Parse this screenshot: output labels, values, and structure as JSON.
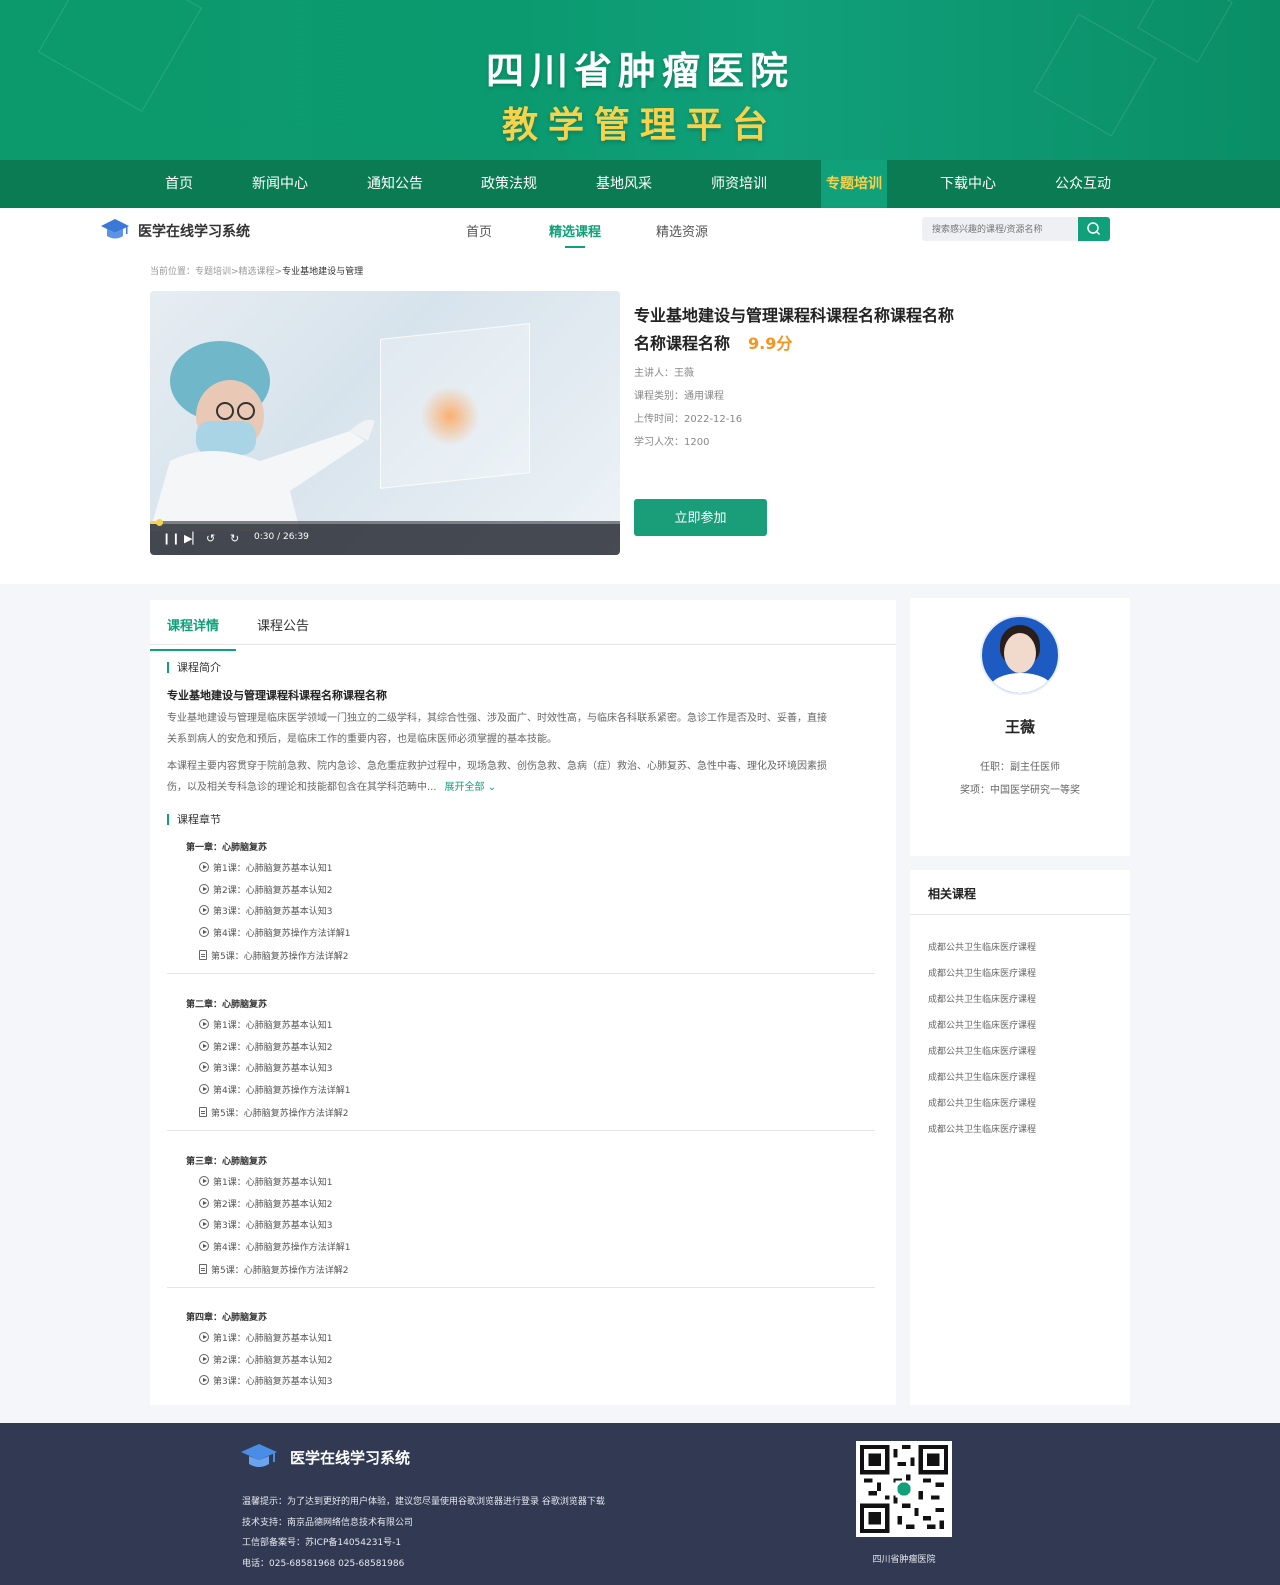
{
  "banner": {
    "line1": "四川省肿瘤医院",
    "line2": "教学管理平台"
  },
  "main_nav": [
    "首页",
    "新闻中心",
    "通知公告",
    "政策法规",
    "基地风采",
    "师资培训",
    "专题培训",
    "下载中心",
    "公众互动"
  ],
  "sub_header": {
    "system_name": "医学在线学习系统",
    "tabs": [
      "首页",
      "精选课程",
      "精选资源"
    ],
    "search_placeholder": "搜索感兴趣的课程/资源名称"
  },
  "breadcrumb": {
    "prefix": "当前位置：专题培训>精选课程>",
    "current": "专业基地建设与管理"
  },
  "video": {
    "time": "0:30 / 26:39",
    "progress": 0.019
  },
  "course": {
    "title_line1": "专业基地建设与管理课程科课程名称课程名称",
    "title_line2": "名称课程名称",
    "score": "9.9分",
    "lecturer": "主讲人：王薇",
    "category": "课程类别：通用课程",
    "upload_time": "上传时间：2022-12-16",
    "learners": "学习人次：1200",
    "join_label": "立即参加"
  },
  "content_tabs": [
    "课程详情",
    "课程公告"
  ],
  "intro": {
    "section_label": "课程简介",
    "title": "专业基地建设与管理课程科课程名称课程名称",
    "p1_line1": "专业基地建设与管理是临床医学领域一门独立的二级学科，其综合性强、涉及面广、时效性高，与临床各科联系紧密。急诊工作是否及时、妥善，直接",
    "p1_line2": "关系到病人的安危和预后，是临床工作的重要内容，也是临床医师必须掌握的基本技能。",
    "p2_line1": "本课程主要内容贯穿于院前急救、院内急诊、急危重症救护过程中，现场急救、创伤急救、急病（症）救治、心肺复苏、急性中毒、理化及环境因素损",
    "p2_line2": "伤，以及相关专科急诊的理论和技能都包含在其学科范畴中...",
    "expand_label": "展开全部 ⌄"
  },
  "chapters_label": "课程章节",
  "chapters": [
    {
      "title": "第一章：心肺脑复苏",
      "lessons": [
        "第1课：心肺脑复苏基本认知1",
        "第2课：心肺脑复苏基本认知2",
        "第3课：心肺脑复苏基本认知3",
        "第4课：心肺脑复苏操作方法详解1",
        "第5课：心肺脑复苏操作方法详解2"
      ]
    },
    {
      "title": "第二章：心肺脑复苏",
      "lessons": [
        "第1课：心肺脑复苏基本认知1",
        "第2课：心肺脑复苏基本认知2",
        "第3课：心肺脑复苏基本认知3",
        "第4课：心肺脑复苏操作方法详解1",
        "第5课：心肺脑复苏操作方法详解2"
      ]
    },
    {
      "title": "第三章：心肺脑复苏",
      "lessons": [
        "第1课：心肺脑复苏基本认知1",
        "第2课：心肺脑复苏基本认知2",
        "第3课：心肺脑复苏基本认知3",
        "第4课：心肺脑复苏操作方法详解1",
        "第5课：心肺脑复苏操作方法详解2"
      ]
    },
    {
      "title": "第四章：心肺脑复苏",
      "lessons": [
        "第1课：心肺脑复苏基本认知1",
        "第2课：心肺脑复苏基本认知2",
        "第3课：心肺脑复苏基本认知3"
      ]
    }
  ],
  "teacher": {
    "name": "王薇",
    "title": "任职：副主任医师",
    "award": "奖项：中国医学研究一等奖"
  },
  "related": {
    "title": "相关课程",
    "items": [
      "成都公共卫生临床医疗课程",
      "成都公共卫生临床医疗课程",
      "成都公共卫生临床医疗课程",
      "成都公共卫生临床医疗课程",
      "成都公共卫生临床医疗课程",
      "成都公共卫生临床医疗课程",
      "成都公共卫生临床医疗课程",
      "成都公共卫生临床医疗课程"
    ]
  },
  "footer": {
    "system_name": "医学在线学习系统",
    "tip": "温馨提示：为了达到更好的用户体验，建议您尽量使用谷歌浏览器进行登录   谷歌浏览器下载",
    "support": "技术支持：南京品德网络信息技术有限公司",
    "icp": "工信部备案号：苏ICP备14054231号-1",
    "phone": "电话：025-68581968   025-68581986",
    "qr_label": "四川省肿瘤医院"
  },
  "colors": {
    "primary": "#10a07a",
    "nav": "#0a7b53",
    "accent": "#f8d24a",
    "score": "#f7931e",
    "footer": "#313a52"
  }
}
